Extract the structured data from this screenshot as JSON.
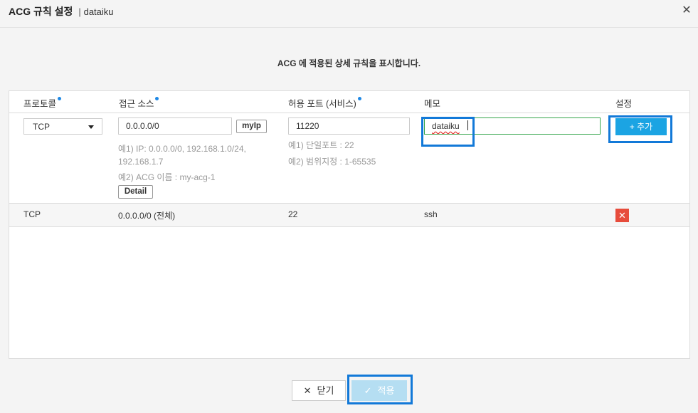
{
  "header": {
    "title": "ACG 규칙 설정",
    "separator": "|",
    "subtitle": "dataiku",
    "close_icon": "close-icon"
  },
  "description": "ACG 에 적용된 상세 규칙을 표시합니다.",
  "columns": {
    "protocol": "프로토콜",
    "source": "접근 소스",
    "port": "허용 포트 (서비스)",
    "memo": "메모",
    "settings": "설정"
  },
  "form": {
    "protocol_selected": "TCP",
    "source_value": "0.0.0.0/0",
    "myip_label": "myIp",
    "source_hint1": "예1) IP: 0.0.0.0/0, 192.168.1.0/24,",
    "source_hint1b": "192.168.1.7",
    "source_hint2": "예2) ACG 이름 : my-acg-1",
    "detail_label": "Detail",
    "port_value": "11220",
    "port_hint1": "예1) 단일포트 : 22",
    "port_hint2": "예2) 범위지정 : 1-65535",
    "memo_value": "dataiku",
    "add_label": "+ 추가"
  },
  "rules": [
    {
      "protocol": "TCP",
      "source": "0.0.0.0/0 (전체)",
      "port": "22",
      "memo": "ssh",
      "delete": "✕"
    }
  ],
  "footer": {
    "close_label": "닫기",
    "close_icon": "✕",
    "apply_label": "적용",
    "apply_icon": "✓"
  }
}
